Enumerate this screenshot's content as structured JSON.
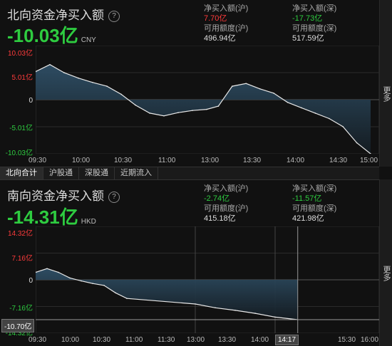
{
  "north": {
    "title": "北向资金净买入额",
    "help_icon": "?",
    "total": "-10.03亿",
    "currency": "CNY",
    "sh_buy_label": "净买入额(沪)",
    "sh_buy_value": "7.70亿",
    "sz_buy_label": "净买入额(深)",
    "sz_buy_value": "-17.73亿",
    "sh_quota_label": "可用额度(沪)",
    "sh_quota_value": "496.94亿",
    "sz_quota_label": "可用额度(深)",
    "sz_quota_value": "517.59亿",
    "y_ticks": [
      "10.03亿",
      "5.01亿",
      "0",
      "-5.01亿",
      "-10.03亿"
    ],
    "x_ticks": [
      "09:30",
      "10:00",
      "10:30",
      "11:00",
      "13:00",
      "13:30",
      "14:00",
      "14:30",
      "15:00"
    ]
  },
  "tabs": [
    "北向合计",
    "沪股通",
    "深股通",
    "近期流入"
  ],
  "side_more": "更多",
  "south": {
    "title": "南向资金净买入额",
    "help_icon": "?",
    "total": "-14.31亿",
    "currency": "HKD",
    "sh_buy_label": "净买入额(沪)",
    "sh_buy_value": "-2.74亿",
    "sz_buy_label": "净买入额(深)",
    "sz_buy_value": "-11.57亿",
    "sh_quota_label": "可用额度(沪)",
    "sh_quota_value": "415.18亿",
    "sz_quota_label": "可用额度(深)",
    "sz_quota_value": "421.98亿",
    "y_ticks": [
      "14.32亿",
      "7.16亿",
      "0",
      "-7.16亿",
      "-14.32亿"
    ],
    "x_ticks": [
      "09:30",
      "10:00",
      "10:30",
      "11:00",
      "11:30",
      "13:00",
      "13:30",
      "14:00",
      "15:30",
      "16:00"
    ],
    "crosshair_value": "-10.70亿",
    "crosshair_time": "14:17"
  },
  "colors": {
    "green": "#2ecc40",
    "red": "#ff3b3b",
    "area_top": "#2f4f66",
    "line": "#e8e8e8"
  },
  "chart_data": [
    {
      "type": "area",
      "title": "北向资金净买入额",
      "ylim": [
        -10.03,
        10.03
      ],
      "unit": "亿",
      "series": [
        {
          "x": [
            "09:30",
            "09:40",
            "09:50",
            "10:00",
            "10:10",
            "10:20",
            "10:30",
            "10:40",
            "10:50",
            "11:00",
            "11:10",
            "11:20",
            "11:30",
            "13:10",
            "13:20",
            "13:30",
            "13:40",
            "13:50",
            "14:00",
            "14:10",
            "14:20",
            "14:30",
            "14:40",
            "14:50",
            "15:00"
          ],
          "values": [
            5.2,
            6.5,
            5.0,
            4.0,
            3.2,
            2.5,
            1.0,
            -1.0,
            -2.5,
            -3.0,
            -2.4,
            -2.0,
            -1.8,
            -1.2,
            2.5,
            3.0,
            2.0,
            1.2,
            -0.5,
            -1.5,
            -2.5,
            -3.5,
            -5.0,
            -8.0,
            -10.03
          ]
        }
      ]
    },
    {
      "type": "area",
      "title": "南向资金净买入额",
      "ylim": [
        -14.32,
        14.32
      ],
      "unit": "亿",
      "series": [
        {
          "x": [
            "09:30",
            "09:45",
            "10:00",
            "10:15",
            "10:30",
            "10:45",
            "11:00",
            "11:15",
            "11:30",
            "13:00",
            "13:15",
            "13:30",
            "13:45",
            "14:00",
            "14:17"
          ],
          "values": [
            2.0,
            3.0,
            2.0,
            0.5,
            -0.3,
            -1.0,
            -1.5,
            -3.5,
            -5.0,
            -6.5,
            -7.5,
            -8.2,
            -9.0,
            -10.0,
            -10.7
          ]
        }
      ]
    }
  ]
}
